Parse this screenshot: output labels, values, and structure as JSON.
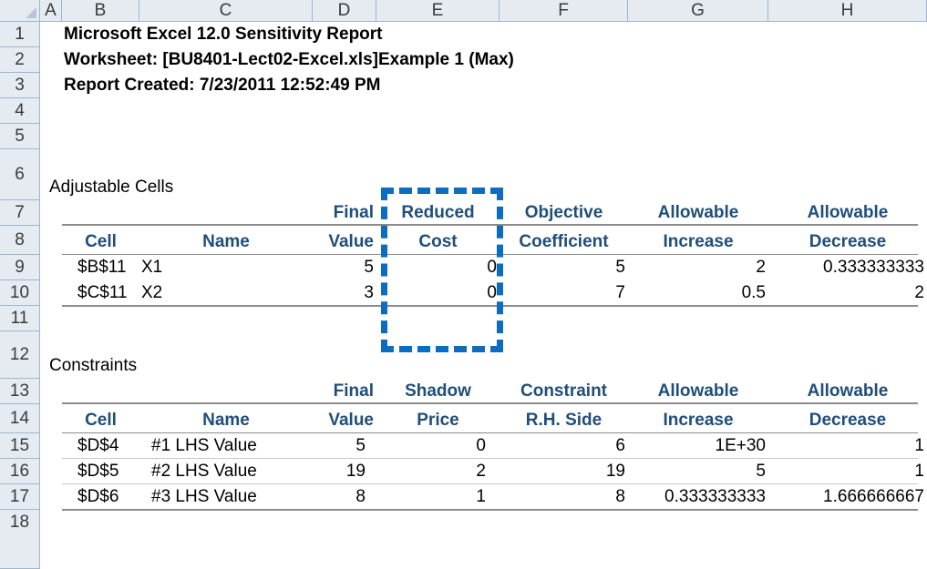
{
  "columns": [
    "A",
    "B",
    "C",
    "D",
    "E",
    "F",
    "G",
    "H"
  ],
  "rows": [
    "1",
    "2",
    "3",
    "4",
    "5",
    "6",
    "7",
    "8",
    "9",
    "10",
    "11",
    "12",
    "13",
    "14",
    "15",
    "16",
    "17",
    "18"
  ],
  "report": {
    "title": "Microsoft Excel 12.0 Sensitivity Report",
    "worksheet": "Worksheet: [BU8401-Lect02-Excel.xls]Example 1 (Max)",
    "created": "Report Created: 7/23/2011 12:52:49 PM"
  },
  "adjustable": {
    "section_label": "Adjustable Cells",
    "header_top": [
      "",
      "",
      "Final",
      "Reduced",
      "Objective",
      "Allowable",
      "Allowable"
    ],
    "header_bottom": [
      "Cell",
      "Name",
      "Value",
      "Cost",
      "Coefficient",
      "Increase",
      "Decrease"
    ],
    "rows": [
      [
        "$B$11",
        "X1",
        "5",
        "0",
        "5",
        "2",
        "0.333333333"
      ],
      [
        "$C$11",
        "X2",
        "3",
        "0",
        "7",
        "0.5",
        "2"
      ]
    ]
  },
  "constraints": {
    "section_label": "Constraints",
    "header_top": [
      "",
      "",
      "Final",
      "Shadow",
      "Constraint",
      "Allowable",
      "Allowable"
    ],
    "header_bottom": [
      "Cell",
      "Name",
      "Value",
      "Price",
      "R.H. Side",
      "Increase",
      "Decrease"
    ],
    "rows": [
      [
        "$D$4",
        "#1 LHS Value",
        "5",
        "0",
        "6",
        "1E+30",
        "1"
      ],
      [
        "$D$5",
        "#2 LHS Value",
        "19",
        "2",
        "19",
        "5",
        "1"
      ],
      [
        "$D$6",
        "#3 LHS Value",
        "8",
        "1",
        "8",
        "0.333333333",
        "1.666666667"
      ]
    ]
  },
  "colors": {
    "highlight": "#0b6cc1",
    "header_text": "#1f4e79",
    "grid_header_bg": "#e6ebf2"
  }
}
